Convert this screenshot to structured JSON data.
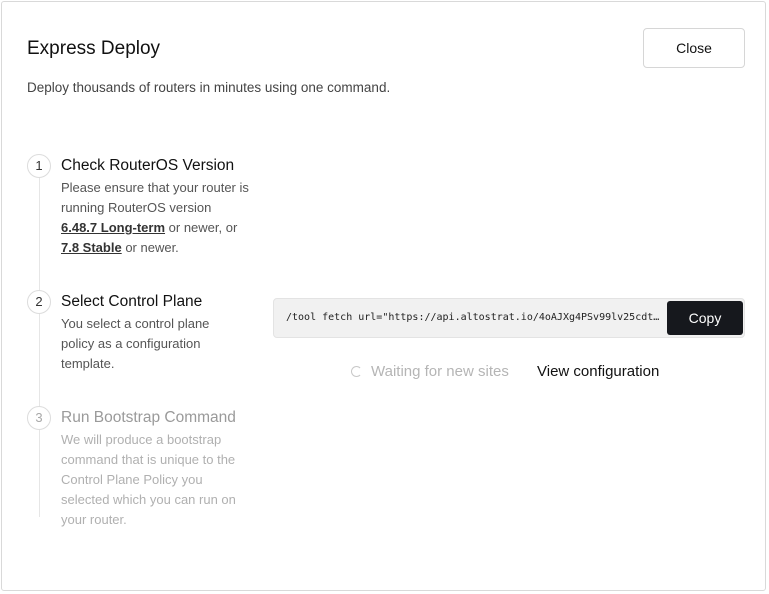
{
  "dialog": {
    "title": "Express Deploy",
    "close_label": "Close",
    "subtitle": "Deploy thousands of routers in minutes using one command."
  },
  "steps": [
    {
      "number": "1",
      "title": "Check RouterOS Version",
      "desc_part1": "Please ensure that your router is running RouterOS version",
      "link1": "6.48.7 Long-term",
      "desc_part2": " or newer, or ",
      "link2": "7.8 Stable",
      "desc_part3": " or newer."
    },
    {
      "number": "2",
      "title": "Select Control Plane",
      "description": "You select a control plane policy as a configuration template."
    },
    {
      "number": "3",
      "title": "Run Bootstrap Command",
      "description": "We will produce a bootstrap command that is unique to the Control Plane Policy you selected which you can run on your router."
    }
  ],
  "command": {
    "text": "/tool fetch url=\"https://api.altostrat.io/4oAJXg4PSv99lv25cdt5…",
    "copy_label": "Copy"
  },
  "status": {
    "waiting_text": "Waiting for new sites",
    "view_config_label": "View configuration"
  },
  "colors": {
    "copy_button_bg": "#16181d",
    "muted_text": "#b5b5b5",
    "border": "#d9d9d9"
  },
  "icons": {
    "spinner": "loading-spinner-icon"
  }
}
